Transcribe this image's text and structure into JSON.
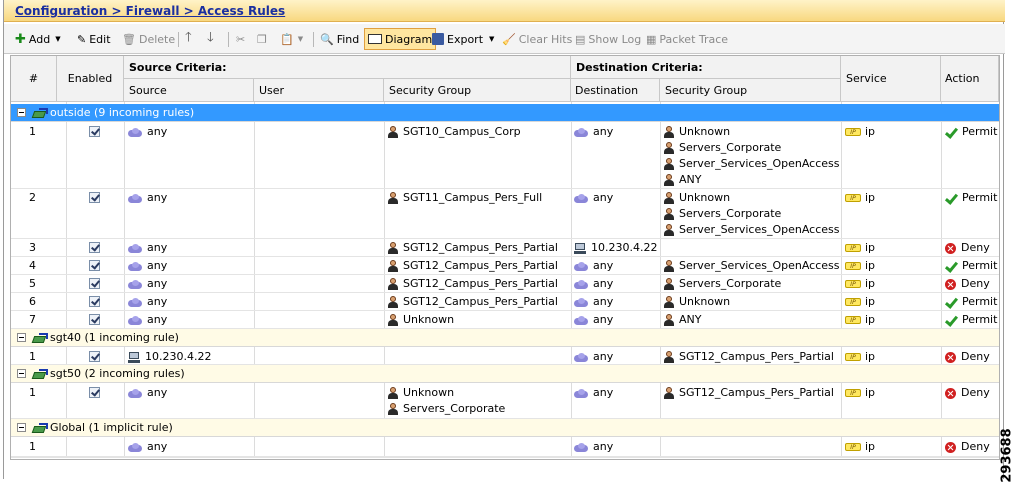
{
  "breadcrumb": "Configuration > Firewall > Access Rules",
  "toolbar": {
    "add": "Add",
    "edit": "Edit",
    "delete": "Delete",
    "find": "Find",
    "diagram": "Diagram",
    "export": "Export",
    "clear_hits": "Clear Hits",
    "show_log": "Show Log",
    "packet_trace": "Packet Trace"
  },
  "columns": {
    "num": "#",
    "enabled": "Enabled",
    "source_criteria": "Source Criteria:",
    "source": "Source",
    "user": "User",
    "security_group": "Security Group",
    "destination_criteria": "Destination Criteria:",
    "destination": "Destination",
    "dest_security_group": "Security Group",
    "service": "Service",
    "action": "Action"
  },
  "groups": [
    {
      "label": "outside (9 incoming rules)",
      "selected": true
    },
    {
      "label": "sgt40 (1 incoming rule)",
      "selected": false
    },
    {
      "label": "sgt50 (2 incoming rules)",
      "selected": false
    },
    {
      "label": "Global (1 implicit rule)",
      "selected": false
    }
  ],
  "rows": [
    {
      "num": "1",
      "source": "any",
      "sg": [
        "SGT10_Campus_Corp"
      ],
      "dest": "any",
      "dsg": [
        "Unknown",
        "Servers_Corporate",
        "Server_Services_OpenAccess",
        "ANY"
      ],
      "service": "ip",
      "action": "Permit"
    },
    {
      "num": "2",
      "source": "any",
      "sg": [
        "SGT11_Campus_Pers_Full"
      ],
      "dest": "any",
      "dsg": [
        "Unknown",
        "Servers_Corporate",
        "Server_Services_OpenAccess"
      ],
      "service": "ip",
      "action": "Permit"
    },
    {
      "num": "3",
      "source": "any",
      "sg": [
        "SGT12_Campus_Pers_Partial"
      ],
      "dest": "10.230.4.22",
      "dsg": [],
      "service": "ip",
      "action": "Deny"
    },
    {
      "num": "4",
      "source": "any",
      "sg": [
        "SGT12_Campus_Pers_Partial"
      ],
      "dest": "any",
      "dsg": [
        "Server_Services_OpenAccess"
      ],
      "service": "ip",
      "action": "Permit"
    },
    {
      "num": "5",
      "source": "any",
      "sg": [
        "SGT12_Campus_Pers_Partial"
      ],
      "dest": "any",
      "dsg": [
        "Servers_Corporate"
      ],
      "service": "ip",
      "action": "Deny"
    },
    {
      "num": "6",
      "source": "any",
      "sg": [
        "SGT12_Campus_Pers_Partial"
      ],
      "dest": "any",
      "dsg": [
        "Unknown"
      ],
      "service": "ip",
      "action": "Permit"
    },
    {
      "num": "7",
      "source": "any",
      "sg": [
        "Unknown"
      ],
      "dest": "any",
      "dsg": [
        "ANY"
      ],
      "service": "ip",
      "action": "Permit"
    },
    {
      "num": "1",
      "source": "10.230.4.22",
      "sg": [],
      "dest": "any",
      "dsg": [
        "SGT12_Campus_Pers_Partial"
      ],
      "service": "ip",
      "action": "Deny"
    },
    {
      "num": "1",
      "source": "any",
      "sg": [
        "Unknown",
        "Servers_Corporate"
      ],
      "dest": "any",
      "dsg": [
        "SGT12_Campus_Pers_Partial"
      ],
      "service": "ip",
      "action": "Deny"
    },
    {
      "num": "1",
      "source": "any",
      "sg": [],
      "dest": "any",
      "dsg": [],
      "service": "ip",
      "action": "Deny"
    }
  ],
  "service_badge": "IP",
  "figure_id": "293688"
}
